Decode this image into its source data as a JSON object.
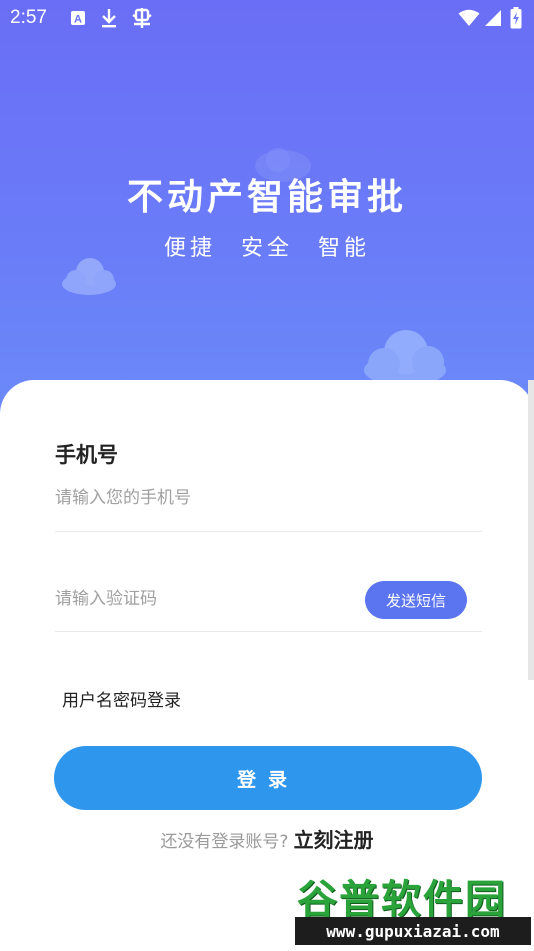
{
  "status_bar": {
    "time": "2:57",
    "icons": [
      "a-badge-icon",
      "download-icon",
      "bug-icon",
      "wifi-icon",
      "signal-icon",
      "battery-charging-icon"
    ]
  },
  "hero": {
    "title": "不动产智能审批",
    "subtitle": "便捷 安全 智能"
  },
  "form": {
    "phone_label": "手机号",
    "phone_placeholder": "请输入您的手机号",
    "code_placeholder": "请输入验证码",
    "send_sms_label": "发送短信",
    "alt_login_label": "用户名密码登录",
    "login_label": "登录",
    "register_prompt": "还没有登录账号?",
    "register_link": "立刻注册"
  },
  "watermark": {
    "title": "谷普软件园",
    "url": "www.gupuxiazai.com"
  },
  "colors": {
    "hero_gradient_top": "#6a6ef6",
    "hero_gradient_bottom": "#6b8cf9",
    "sms_button": "#5b74ef",
    "login_button": "#2f96ee",
    "watermark_green": "#2aa43a"
  }
}
